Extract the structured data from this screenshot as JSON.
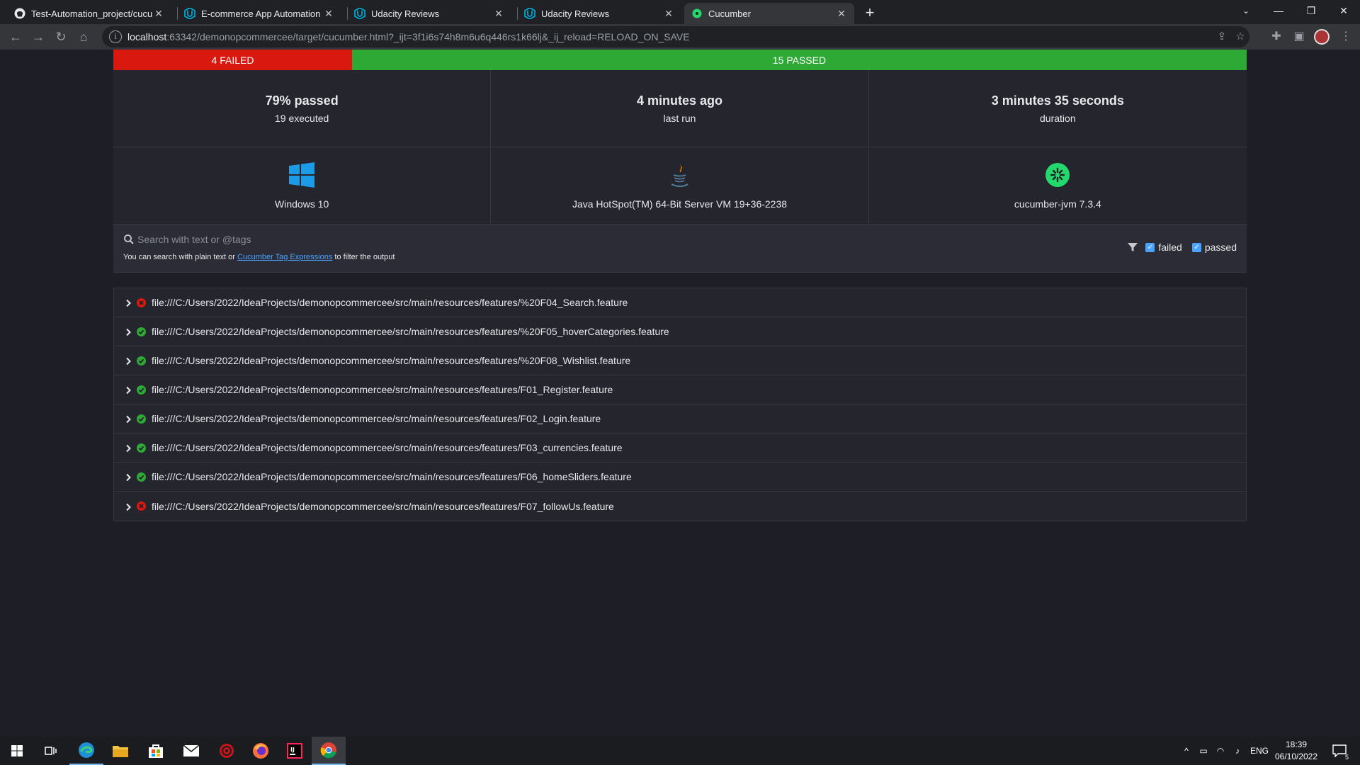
{
  "browser": {
    "tabs": [
      {
        "title": "Test-Automation_project/cucumb",
        "icon": "github-icon"
      },
      {
        "title": "E-commerce App Automation Te",
        "icon": "udacity-icon"
      },
      {
        "title": "Udacity Reviews",
        "icon": "udacity-icon"
      },
      {
        "title": "Udacity Reviews",
        "icon": "udacity-icon"
      },
      {
        "title": "Cucumber",
        "icon": "cucumber-icon"
      }
    ],
    "url_host": "localhost",
    "url_rest": ":63342/demonopcommercee/target/cucumber.html?_ijt=3f1i6s74h8m6u6q446rs1k66lj&_ij_reload=RELOAD_ON_SAVE"
  },
  "report": {
    "failed_label": "4 FAILED",
    "passed_label": "15 PASSED",
    "failed_count": 4,
    "passed_count": 15,
    "colors": {
      "failed": "#d9190f",
      "passed": "#2ea936",
      "link": "#4aa3ff"
    },
    "stats": {
      "passed_pct": "79% passed",
      "executed": "19 executed",
      "last_run": "4 minutes ago",
      "last_run_label": "last run",
      "duration": "3 minutes 35 seconds",
      "duration_label": "duration"
    },
    "env": {
      "os": "Windows 10",
      "runtime": "Java HotSpot(TM) 64-Bit Server VM 19+36-2238",
      "tool": "cucumber-jvm 7.3.4"
    },
    "search": {
      "placeholder": "Search with text or @tags",
      "help_prefix": "You can search with plain text or",
      "help_link": "Cucumber Tag Expressions",
      "help_suffix": "to filter the output"
    },
    "filters": {
      "failed": "failed",
      "passed": "passed"
    },
    "features": [
      {
        "path": "file:///C:/Users/2022/IdeaProjects/demonopcommercee/src/main/resources/features/%20F04_Search.feature",
        "status": "failed"
      },
      {
        "path": "file:///C:/Users/2022/IdeaProjects/demonopcommercee/src/main/resources/features/%20F05_hoverCategories.feature",
        "status": "passed"
      },
      {
        "path": "file:///C:/Users/2022/IdeaProjects/demonopcommercee/src/main/resources/features/%20F08_Wishlist.feature",
        "status": "passed"
      },
      {
        "path": "file:///C:/Users/2022/IdeaProjects/demonopcommercee/src/main/resources/features/F01_Register.feature",
        "status": "passed"
      },
      {
        "path": "file:///C:/Users/2022/IdeaProjects/demonopcommercee/src/main/resources/features/F02_Login.feature",
        "status": "passed"
      },
      {
        "path": "file:///C:/Users/2022/IdeaProjects/demonopcommercee/src/main/resources/features/F03_currencies.feature",
        "status": "passed"
      },
      {
        "path": "file:///C:/Users/2022/IdeaProjects/demonopcommercee/src/main/resources/features/F06_homeSliders.feature",
        "status": "passed"
      },
      {
        "path": "file:///C:/Users/2022/IdeaProjects/demonopcommercee/src/main/resources/features/F07_followUs.feature",
        "status": "failed"
      }
    ]
  },
  "taskbar": {
    "lang": "ENG",
    "time": "18:39",
    "date": "06/10/2022",
    "notifications": "5"
  }
}
